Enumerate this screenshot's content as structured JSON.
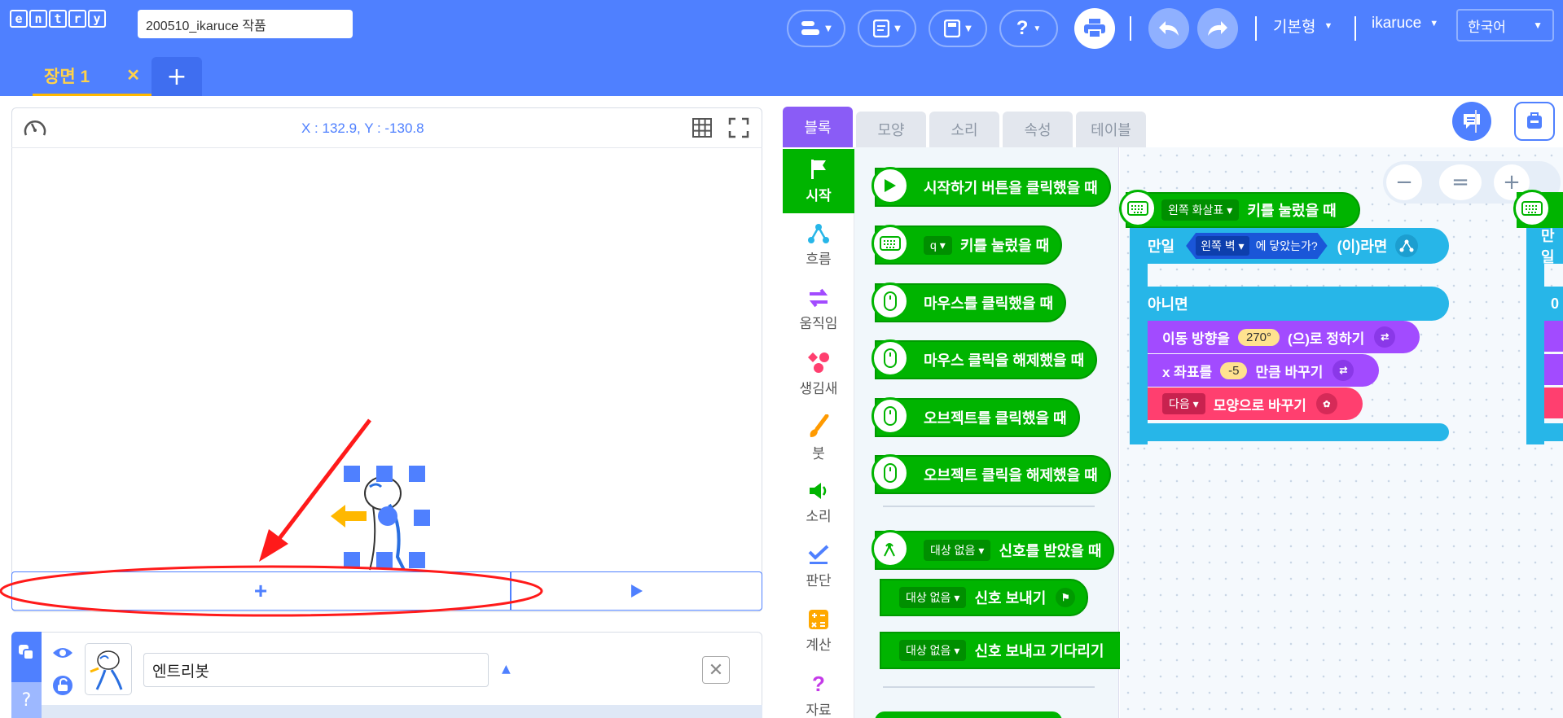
{
  "header": {
    "logo_letters": [
      "e",
      "n",
      "t",
      "r",
      "y"
    ],
    "project_title": "200510_ikaruce 작품",
    "mode_label": "기본형",
    "user_label": "ikaruce",
    "language_label": "한국어",
    "help_label": "?"
  },
  "scenes": {
    "tabs": [
      {
        "label": "장면 1"
      }
    ],
    "close_label": "✕",
    "add_label": "+"
  },
  "stage": {
    "coordinates": "X : 132.9, Y : -130.8",
    "add_label": "+"
  },
  "object": {
    "name_value": "엔트리봇"
  },
  "block_tabs": [
    "블록",
    "모양",
    "소리",
    "속성",
    "테이블"
  ],
  "categories": [
    {
      "label": "시작",
      "icon": "flag-icon"
    },
    {
      "label": "흐름",
      "icon": "flow-icon"
    },
    {
      "label": "움직임",
      "icon": "arrows-icon"
    },
    {
      "label": "생김새",
      "icon": "shapes-icon"
    },
    {
      "label": "붓",
      "icon": "brush-icon"
    },
    {
      "label": "소리",
      "icon": "speaker-icon"
    },
    {
      "label": "판단",
      "icon": "check-icon"
    },
    {
      "label": "계산",
      "icon": "calculator-icon"
    },
    {
      "label": "자료",
      "icon": "question-icon"
    }
  ],
  "palette": {
    "blocks": [
      {
        "text": "시작하기 버튼을 클릭했을 때"
      },
      {
        "dropdown": "q",
        "text": "키를 눌렀을 때"
      },
      {
        "text": "마우스를 클릭했을 때"
      },
      {
        "text": "마우스 클릭을 해제했을 때"
      },
      {
        "text": "오브젝트를 클릭했을 때"
      },
      {
        "text": "오브젝트 클릭을 해제했을 때"
      },
      {
        "dropdown": "대상 없음",
        "text": "신호를 받았을 때"
      },
      {
        "dropdown": "대상 없음",
        "text": "신호 보내기"
      },
      {
        "dropdown": "대상 없음",
        "text": "신호 보내고 기다리기"
      }
    ]
  },
  "script": {
    "hat": {
      "dropdown": "왼쪽 화살표",
      "text": "키를 눌렀을 때"
    },
    "if_label": "만일",
    "condition_dropdown": "왼쪽 벽",
    "condition_text": "에 닿았는가?",
    "then_label": "(이)라면",
    "else_label": "아니면",
    "set_direction": {
      "prefix": "이동 방향을",
      "value": "270°",
      "suffix": "(으)로 정하기"
    },
    "change_x": {
      "prefix": "x 좌표를",
      "value": "-5",
      "suffix": "만큼 바꾸기"
    },
    "next_shape": {
      "dropdown": "다음",
      "suffix": "모양으로 바꾸기"
    },
    "second_if_label": "만일",
    "second_digit": "0"
  },
  "zoom": {
    "minus": "−",
    "reset": "=",
    "plus": "+"
  },
  "colors": {
    "brand": "#4f80ff",
    "start_green": "#00b400",
    "flow_blue": "#27b6e8",
    "move_purple": "#a24bff",
    "looks_red": "#ff3f6f",
    "annotation_red": "#ff1a1a"
  }
}
